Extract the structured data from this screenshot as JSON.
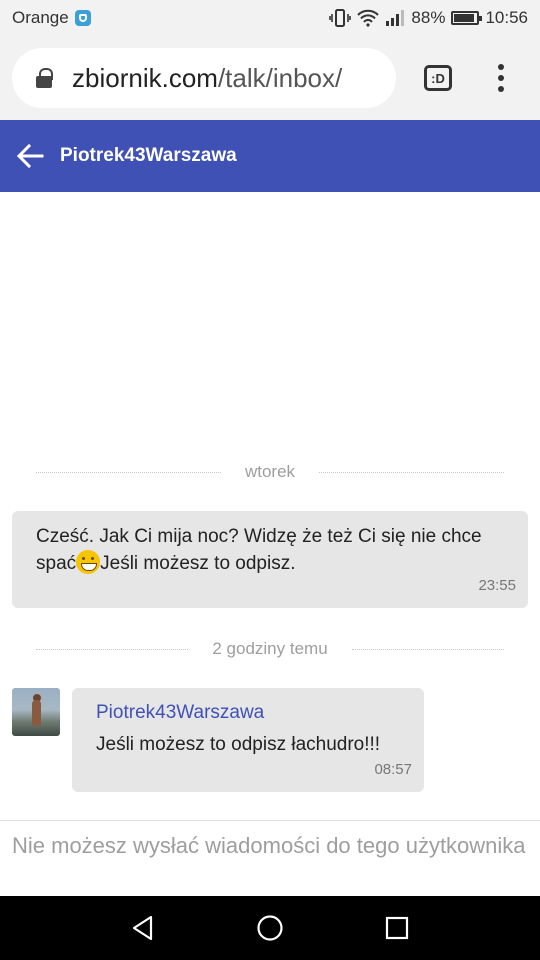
{
  "status_bar": {
    "carrier": "Orange",
    "battery": "88%",
    "time": "10:56"
  },
  "browser": {
    "url_domain": "zbiornik.com",
    "url_path": "/talk/inbox/",
    "tabs_label": ":D"
  },
  "header": {
    "title": "Piotrek43Warszawa"
  },
  "chat": {
    "dividers": [
      "wtorek",
      "2 godziny temu"
    ],
    "messages": [
      {
        "text_before_emoji": "Cześć. Jak Ci mija noc? Widzę że też Ci się nie chce spać",
        "emoji": "grinning-face",
        "text_after_emoji": "Jeśli możesz to odpisz.",
        "time": "23:55"
      },
      {
        "sender": "Piotrek43Warszawa",
        "text": "Jeśli możesz to odpisz łachudro!!!",
        "time": "08:57"
      }
    ]
  },
  "notice": "Nie możesz wysłać wiadomości do tego użytkownika"
}
